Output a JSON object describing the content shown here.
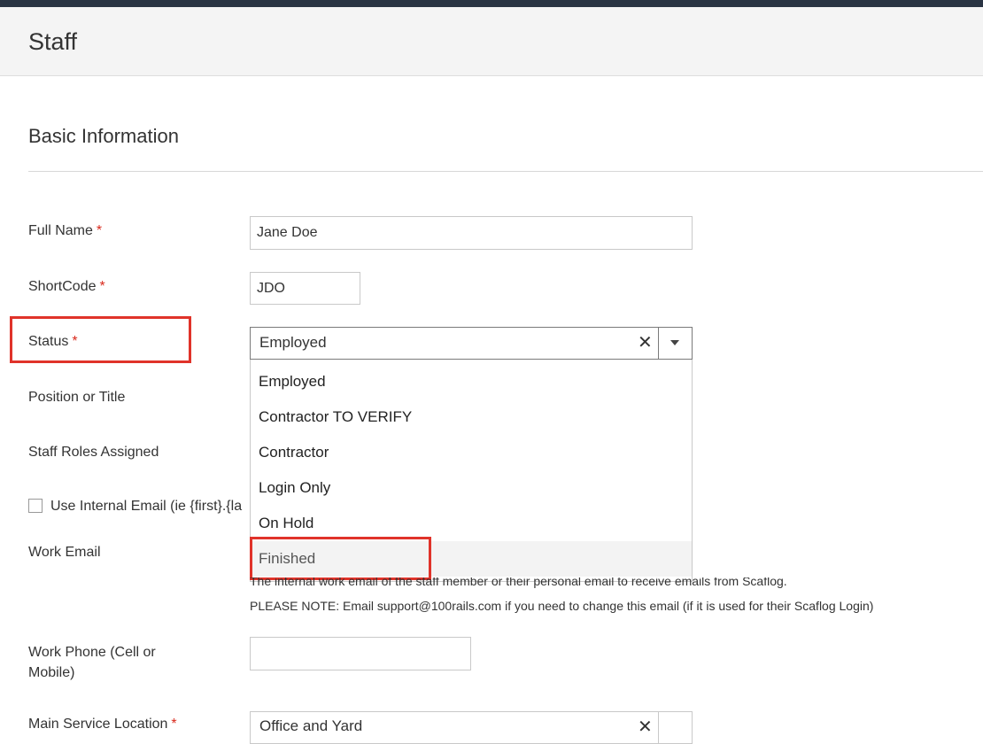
{
  "page": {
    "title": "Staff"
  },
  "section": {
    "title": "Basic Information"
  },
  "form": {
    "full_name": {
      "label": "Full Name",
      "value": "Jane Doe"
    },
    "short_code": {
      "label": "ShortCode",
      "value": "JDO"
    },
    "status": {
      "label": "Status",
      "value": "Employed",
      "options": [
        "Employed",
        "Contractor TO VERIFY",
        "Contractor",
        "Login Only",
        "On Hold",
        "Finished"
      ],
      "highlighted_option": "Finished"
    },
    "position": {
      "label": "Position or Title"
    },
    "roles": {
      "label": "Staff Roles Assigned"
    },
    "internal_email": {
      "label": "Use Internal Email (ie {first}.{la"
    },
    "work_email": {
      "label": "Work Email",
      "help_line_1": "The internal work email of the staff member or their personal email to receive emails from Scaflog.",
      "help_line_2": "PLEASE NOTE: Email support@100rails.com if you need to change this email (if it is used for their Scaflog Login)"
    },
    "work_phone": {
      "label_line_1": "Work Phone (Cell or",
      "label_line_2": "Mobile)",
      "value": ""
    },
    "main_service_location": {
      "label": "Main Service Location",
      "value": "Office and Yard"
    }
  },
  "required_marker": "*",
  "colors": {
    "topbar": "#2a3443",
    "required": "#d9291c",
    "highlight_box": "#e0332a"
  }
}
